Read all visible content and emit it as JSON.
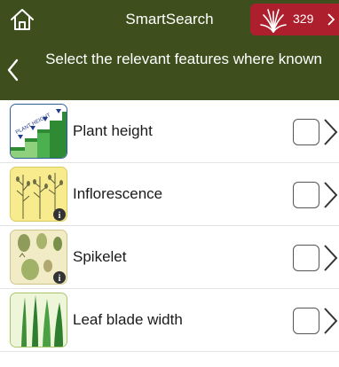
{
  "header": {
    "title": "SmartSearch",
    "results_count": "329"
  },
  "subheader": {
    "instruction": "Select the relevant features where known"
  },
  "features": [
    {
      "label": "Plant height",
      "checked": false,
      "thumb_text": "PLANT HEIGHT",
      "info": false
    },
    {
      "label": "Inflorescence",
      "checked": false,
      "info": true
    },
    {
      "label": "Spikelet",
      "checked": false,
      "info": true
    },
    {
      "label": "Leaf blade width",
      "checked": false,
      "info": false
    }
  ],
  "colors": {
    "header_bg": "#3e4f1d",
    "badge_bg": "#ad1f2c",
    "row_divider": "#e3e3e3"
  },
  "icons": {
    "home": "home-icon",
    "grass": "grass-icon",
    "back": "chevron-left-icon",
    "forward": "chevron-right-icon"
  }
}
